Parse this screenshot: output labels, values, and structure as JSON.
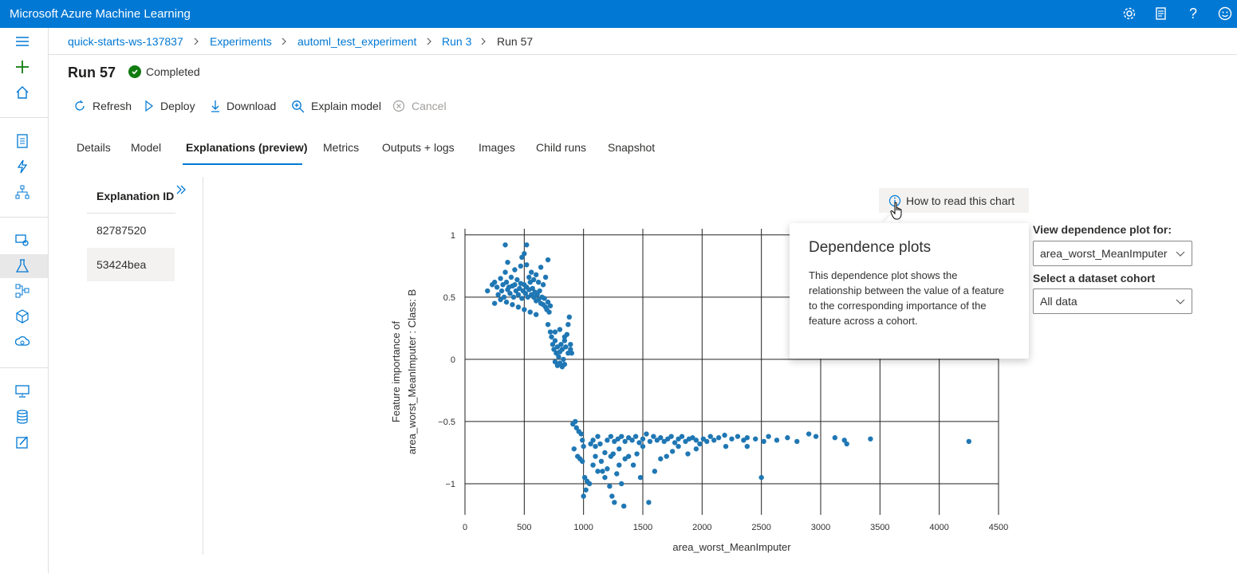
{
  "app": {
    "title": "Microsoft Azure Machine Learning"
  },
  "topbar": {
    "icons": [
      "gear-icon",
      "feedback-list-icon",
      "help-icon",
      "smiley-icon"
    ]
  },
  "breadcrumb": [
    "quick-starts-ws-137837",
    "Experiments",
    "automl_test_experiment",
    "Run 3",
    "Run 57"
  ],
  "run": {
    "title": "Run 57",
    "status": "Completed"
  },
  "toolbar": {
    "refresh": "Refresh",
    "deploy": "Deploy",
    "download": "Download",
    "explain": "Explain model",
    "cancel": "Cancel"
  },
  "tabs": [
    "Details",
    "Model",
    "Explanations (preview)",
    "Metrics",
    "Outputs + logs",
    "Images",
    "Child runs",
    "Snapshot"
  ],
  "explanations": {
    "header": "Explanation ID",
    "ids": [
      "82787520",
      "53424bea"
    ]
  },
  "howto": {
    "label": "How to read this chart"
  },
  "callout": {
    "title": "Dependence plots",
    "body": "This dependence plot shows the relationship between the value of a feature to the corresponding importance of the feature across a cohort."
  },
  "controls": {
    "feature_label": "View dependence plot for:",
    "feature_value": "area_worst_MeanImputer",
    "cohort_label": "Select a dataset cohort",
    "cohort_value": "All data"
  },
  "chart_data": {
    "type": "scatter",
    "xlabel": "area_worst_MeanImputer",
    "ylabel_line1": "Feature importance of",
    "ylabel_line2": "area_worst_MeanImputer : Class: B",
    "xlim": [
      0,
      4500
    ],
    "ylim": [
      -1.25,
      1.05
    ],
    "xticks": [
      0,
      500,
      1000,
      1500,
      2000,
      2500,
      3000,
      3500,
      4000,
      4500
    ],
    "yticks": [
      1,
      0.5,
      0,
      -0.5,
      -1
    ],
    "ytick_labels": [
      "1",
      "0.5",
      "0",
      "−0.5",
      "−1"
    ],
    "grid": true,
    "color": "#1f77b4",
    "points": [
      [
        190,
        0.55
      ],
      [
        230,
        0.6
      ],
      [
        250,
        0.62
      ],
      [
        270,
        0.58
      ],
      [
        280,
        0.52
      ],
      [
        300,
        0.65
      ],
      [
        310,
        0.55
      ],
      [
        320,
        0.6
      ],
      [
        330,
        0.5
      ],
      [
        340,
        0.7
      ],
      [
        350,
        0.62
      ],
      [
        360,
        0.56
      ],
      [
        370,
        0.58
      ],
      [
        380,
        0.53
      ],
      [
        390,
        0.66
      ],
      [
        400,
        0.59
      ],
      [
        410,
        0.5
      ],
      [
        420,
        0.6
      ],
      [
        430,
        0.55
      ],
      [
        440,
        0.64
      ],
      [
        450,
        0.52
      ],
      [
        460,
        0.57
      ],
      [
        470,
        0.61
      ],
      [
        480,
        0.49
      ],
      [
        490,
        0.55
      ],
      [
        500,
        0.6
      ],
      [
        510,
        0.53
      ],
      [
        520,
        0.58
      ],
      [
        530,
        0.5
      ],
      [
        540,
        0.56
      ],
      [
        550,
        0.62
      ],
      [
        560,
        0.52
      ],
      [
        570,
        0.57
      ],
      [
        580,
        0.5
      ],
      [
        590,
        0.54
      ],
      [
        600,
        0.47
      ],
      [
        610,
        0.52
      ],
      [
        620,
        0.48
      ],
      [
        630,
        0.55
      ],
      [
        640,
        0.45
      ],
      [
        650,
        0.5
      ],
      [
        660,
        0.44
      ],
      [
        670,
        0.49
      ],
      [
        680,
        0.42
      ],
      [
        690,
        0.4
      ],
      [
        700,
        0.46
      ],
      [
        710,
        0.38
      ],
      [
        720,
        0.43
      ],
      [
        360,
        0.78
      ],
      [
        420,
        0.72
      ],
      [
        480,
        0.82
      ],
      [
        520,
        0.76
      ],
      [
        560,
        0.7
      ],
      [
        600,
        0.68
      ],
      [
        640,
        0.74
      ],
      [
        680,
        0.66
      ],
      [
        700,
        0.8
      ],
      [
        340,
        0.92
      ],
      [
        520,
        0.92
      ],
      [
        500,
        0.85
      ],
      [
        470,
        0.75
      ],
      [
        540,
        0.66
      ],
      [
        580,
        0.64
      ],
      [
        620,
        0.62
      ],
      [
        660,
        0.6
      ],
      [
        250,
        0.45
      ],
      [
        300,
        0.48
      ],
      [
        350,
        0.46
      ],
      [
        400,
        0.44
      ],
      [
        450,
        0.42
      ],
      [
        500,
        0.4
      ],
      [
        550,
        0.38
      ],
      [
        600,
        0.36
      ],
      [
        700,
        0.28
      ],
      [
        720,
        0.22
      ],
      [
        730,
        0.18
      ],
      [
        740,
        0.12
      ],
      [
        750,
        0.08
      ],
      [
        760,
        0.15
      ],
      [
        770,
        0.05
      ],
      [
        780,
        0.1
      ],
      [
        790,
        0.02
      ],
      [
        800,
        0.06
      ],
      [
        810,
        0.12
      ],
      [
        820,
        0.08
      ],
      [
        830,
        0.0
      ],
      [
        840,
        0.15
      ],
      [
        850,
        0.1
      ],
      [
        860,
        0.2
      ],
      [
        870,
        0.28
      ],
      [
        880,
        0.34
      ],
      [
        890,
        0.12
      ],
      [
        900,
        0.05
      ],
      [
        760,
        -0.02
      ],
      [
        780,
        -0.05
      ],
      [
        800,
        -0.03
      ],
      [
        820,
        -0.06
      ],
      [
        840,
        -0.04
      ],
      [
        760,
        0.22
      ],
      [
        800,
        0.24
      ],
      [
        840,
        0.18
      ],
      [
        870,
        0.05
      ],
      [
        890,
        0.08
      ],
      [
        910,
        -0.52
      ],
      [
        930,
        -0.5
      ],
      [
        940,
        -0.55
      ],
      [
        960,
        -0.58
      ],
      [
        980,
        -0.6
      ],
      [
        990,
        -0.65
      ],
      [
        1000,
        -0.7
      ],
      [
        920,
        -0.72
      ],
      [
        950,
        -0.78
      ],
      [
        970,
        -0.8
      ],
      [
        990,
        -0.82
      ],
      [
        1010,
        -0.95
      ],
      [
        1030,
        -0.98
      ],
      [
        1050,
        -1.0
      ],
      [
        1000,
        -1.1
      ],
      [
        1020,
        -1.05
      ],
      [
        1060,
        -0.68
      ],
      [
        1080,
        -0.65
      ],
      [
        1100,
        -0.7
      ],
      [
        1120,
        -0.62
      ],
      [
        1140,
        -0.68
      ],
      [
        1160,
        -0.9
      ],
      [
        1180,
        -0.95
      ],
      [
        1200,
        -0.88
      ],
      [
        1220,
        -1.02
      ],
      [
        1240,
        -1.1
      ],
      [
        1260,
        -1.15
      ],
      [
        1280,
        -0.92
      ],
      [
        1300,
        -0.85
      ],
      [
        1320,
        -1.0
      ],
      [
        1340,
        -1.18
      ],
      [
        1200,
        -0.65
      ],
      [
        1230,
        -0.62
      ],
      [
        1260,
        -0.66
      ],
      [
        1290,
        -0.64
      ],
      [
        1320,
        -0.62
      ],
      [
        1350,
        -0.66
      ],
      [
        1380,
        -0.63
      ],
      [
        1410,
        -0.65
      ],
      [
        1440,
        -0.62
      ],
      [
        1470,
        -0.67
      ],
      [
        1500,
        -0.64
      ],
      [
        1530,
        -0.6
      ],
      [
        1560,
        -0.66
      ],
      [
        1590,
        -0.62
      ],
      [
        1620,
        -0.65
      ],
      [
        1650,
        -0.63
      ],
      [
        1680,
        -0.66
      ],
      [
        1710,
        -0.64
      ],
      [
        1740,
        -0.62
      ],
      [
        1770,
        -0.67
      ],
      [
        1800,
        -0.64
      ],
      [
        1830,
        -0.62
      ],
      [
        1860,
        -0.66
      ],
      [
        1890,
        -0.64
      ],
      [
        1920,
        -0.63
      ],
      [
        1950,
        -0.65
      ],
      [
        1980,
        -0.68
      ],
      [
        2010,
        -0.64
      ],
      [
        2040,
        -0.66
      ],
      [
        2070,
        -0.62
      ],
      [
        2100,
        -0.65
      ],
      [
        2140,
        -0.63
      ],
      [
        2190,
        -0.61
      ],
      [
        2250,
        -0.64
      ],
      [
        2300,
        -0.62
      ],
      [
        2350,
        -0.65
      ],
      [
        2380,
        -0.63
      ],
      [
        2450,
        -0.64
      ],
      [
        2520,
        -0.66
      ],
      [
        2560,
        -0.62
      ],
      [
        2630,
        -0.65
      ],
      [
        2720,
        -0.63
      ],
      [
        2800,
        -0.66
      ],
      [
        2900,
        -0.6
      ],
      [
        2960,
        -0.62
      ],
      [
        3120,
        -0.63
      ],
      [
        3200,
        -0.65
      ],
      [
        3220,
        -0.68
      ],
      [
        3420,
        -0.64
      ],
      [
        4250,
        -0.66
      ],
      [
        2500,
        -0.95
      ],
      [
        1550,
        -1.15
      ],
      [
        1480,
        -0.95
      ],
      [
        1420,
        -0.85
      ],
      [
        1380,
        -0.78
      ],
      [
        1600,
        -0.9
      ],
      [
        1650,
        -0.8
      ],
      [
        1700,
        -0.78
      ],
      [
        1750,
        -0.74
      ],
      [
        1800,
        -0.7
      ],
      [
        1880,
        -0.76
      ],
      [
        1950,
        -0.72
      ],
      [
        2200,
        -0.7
      ],
      [
        2380,
        -0.7
      ],
      [
        1100,
        -0.78
      ],
      [
        1150,
        -0.82
      ],
      [
        1250,
        -0.76
      ],
      [
        1350,
        -0.8
      ],
      [
        1450,
        -0.76
      ],
      [
        1500,
        -0.7
      ],
      [
        1080,
        -0.85
      ],
      [
        1120,
        -0.9
      ],
      [
        1180,
        -0.75
      ],
      [
        1230,
        -0.78
      ],
      [
        1300,
        -0.72
      ]
    ]
  }
}
